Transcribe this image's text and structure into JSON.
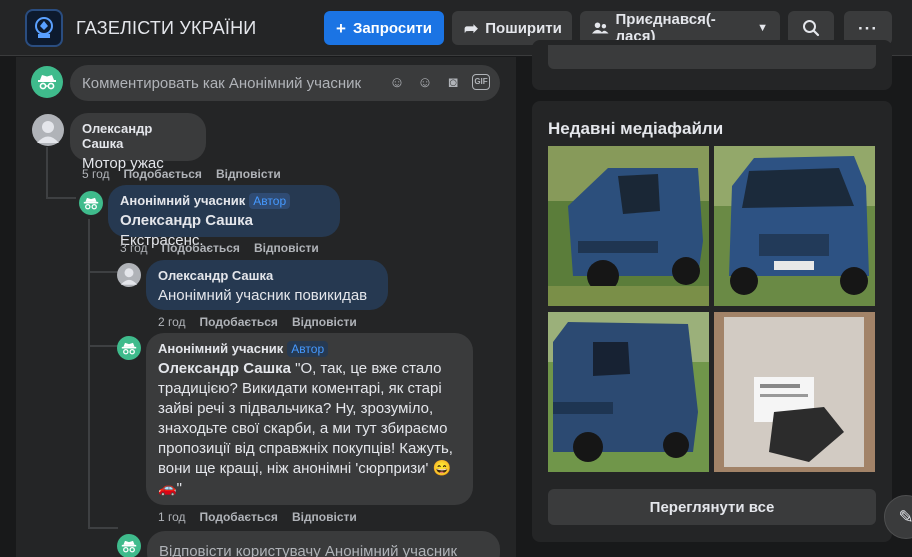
{
  "header": {
    "group_title": "ГАЗЕЛІСТИ УКРАЇНИ",
    "invite_label": "Запросити",
    "share_label": "Поширити",
    "joined_label": "Приєднався(-лася)"
  },
  "composer": {
    "placeholder": "Комментировать как Анонімний учасник"
  },
  "comments": [
    {
      "author": "Олександр Сашка",
      "text": "Мотор ужас",
      "time": "5 год",
      "like": "Подобається",
      "reply": "Відповісти"
    },
    {
      "author": "Анонімний учасник",
      "badge": "Автор",
      "mention": "Олександр Сашка",
      "text": " Екстрасенс.",
      "time": "3 год",
      "like": "Подобається",
      "reply": "Відповісти"
    },
    {
      "author": "Олександр Сашка",
      "mention": "Анонімний учасник",
      "text": " повикидав",
      "time": "2 год",
      "like": "Подобається",
      "reply": "Відповісти"
    },
    {
      "author": "Анонімний учасник",
      "badge": "Автор",
      "mention": "Олександр Сашка",
      "text": " \"О, так, це вже стало традицією? Викидати коментарі, як старі зайві речі з підвальчика? Ну, зрозуміло, знаходьте свої скарби, а ми тут збираємо пропозиції від справжніх покупців! Кажуть, вони ще кращі, ніж анонімні 'сюрпризи' 😄🚗\"",
      "time": "1 год",
      "like": "Подобається",
      "reply": "Відповісти"
    }
  ],
  "reply_box": {
    "placeholder": "Відповісти користувачу Анонімний учасник"
  },
  "media": {
    "title": "Недавні медіафайли",
    "see_all_label": "Переглянути все"
  },
  "colors": {
    "accent": "#1b74e4",
    "anon_avatar": "#3fbb8c",
    "background": "#18191a",
    "card": "#242526"
  }
}
